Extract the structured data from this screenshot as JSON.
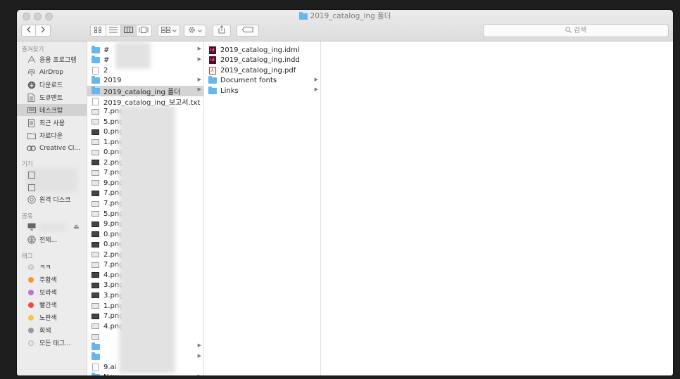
{
  "window": {
    "title": "2019_catalog_ing 폴더"
  },
  "toolbar": {
    "back_icon": "chevron-left-icon",
    "forward_icon": "chevron-right-icon",
    "view_modes": [
      "icon-view-icon",
      "list-view-icon",
      "column-view-icon",
      "gallery-view-icon"
    ],
    "search_placeholder": "검색"
  },
  "sidebar": {
    "favorites_header": "즐겨찾기",
    "favorites": [
      {
        "label": "응용 프로그램",
        "icon": "applications-icon"
      },
      {
        "label": "AirDrop",
        "icon": "airdrop-icon"
      },
      {
        "label": "다운로드",
        "icon": "download-icon"
      },
      {
        "label": "도큐멘트",
        "icon": "document-icon"
      },
      {
        "label": "데스크탑",
        "icon": "desktop-icon"
      },
      {
        "label": "최근 사용",
        "icon": "recents-icon"
      },
      {
        "label": "자료다운",
        "icon": "folder-icon"
      },
      {
        "label": "Creative Cl...",
        "icon": "creative-cloud-icon"
      }
    ],
    "devices_header": "기기",
    "devices": [
      {
        "label": "원격 디스크",
        "icon": "remote-disc-icon"
      }
    ],
    "shared_header": "공유",
    "shared": [
      {
        "label": "전체...",
        "icon": "network-icon"
      }
    ],
    "tags_header": "태그",
    "tags": [
      {
        "label": "ㅋㅋ",
        "color": "#d8d8d8"
      },
      {
        "label": "주황색",
        "color": "#f39a2d"
      },
      {
        "label": "보라색",
        "color": "#c06fd9"
      },
      {
        "label": "빨간색",
        "color": "#ee4a4a"
      },
      {
        "label": "노란색",
        "color": "#f2c93a"
      },
      {
        "label": "회색",
        "color": "#9a9a9a"
      },
      {
        "label": "모든 태그...",
        "color": "#d0d0d0"
      }
    ]
  },
  "column1": {
    "items": [
      {
        "label": "#",
        "kind": "folder",
        "arrow": true
      },
      {
        "label": "#",
        "kind": "folder",
        "arrow": true
      },
      {
        "label": "2",
        "kind": "doc",
        "arrow": false
      },
      {
        "label": "2019",
        "kind": "folder",
        "arrow": true
      },
      {
        "label": "2019_catalog_ing 폴더",
        "kind": "folder",
        "arrow": true,
        "selected": true
      },
      {
        "label": "2019_catalog_ing_보고서.txt",
        "kind": "doc",
        "arrow": false
      },
      {
        "label": "7.png",
        "kind": "thumb"
      },
      {
        "label": "5.png",
        "kind": "thumb"
      },
      {
        "label": "0.png",
        "kind": "thumb-dark"
      },
      {
        "label": "1.png",
        "kind": "thumb"
      },
      {
        "label": "0.png",
        "kind": "thumb"
      },
      {
        "label": "2.png",
        "kind": "thumb-dark"
      },
      {
        "label": "7.png",
        "kind": "thumb"
      },
      {
        "label": "9.png",
        "kind": "thumb"
      },
      {
        "label": "7.png",
        "kind": "thumb-dark"
      },
      {
        "label": "7.png",
        "kind": "thumb"
      },
      {
        "label": "5.png",
        "kind": "thumb"
      },
      {
        "label": "9.png",
        "kind": "thumb-dark"
      },
      {
        "label": "0.png",
        "kind": "thumb-dark"
      },
      {
        "label": "0.png",
        "kind": "thumb-dark"
      },
      {
        "label": "2.png",
        "kind": "thumb"
      },
      {
        "label": "7.png",
        "kind": "thumb"
      },
      {
        "label": "4.png",
        "kind": "thumb-dark"
      },
      {
        "label": "3.png",
        "kind": "thumb-dark"
      },
      {
        "label": "3.png",
        "kind": "thumb-dark"
      },
      {
        "label": "1.png",
        "kind": "thumb"
      },
      {
        "label": "7.png",
        "kind": "thumb-dark"
      },
      {
        "label": "4.png",
        "kind": "thumb"
      },
      {
        "label": "",
        "kind": "image"
      },
      {
        "label": "",
        "kind": "folder",
        "arrow": true
      },
      {
        "label": "",
        "kind": "folder",
        "arrow": true
      },
      {
        "label": "9.ai",
        "kind": "doc"
      },
      {
        "label": "New",
        "kind": "folder",
        "arrow": true
      }
    ]
  },
  "column2": {
    "items": [
      {
        "label": "2019_catalog_ing.idml",
        "kind": "indesign",
        "arrow": false
      },
      {
        "label": "2019_catalog_ing.indd",
        "kind": "indesign",
        "arrow": false
      },
      {
        "label": "2019_catalog_ing.pdf",
        "kind": "pdf",
        "arrow": false
      },
      {
        "label": "Document fonts",
        "kind": "folder",
        "arrow": true
      },
      {
        "label": "Links",
        "kind": "folder",
        "arrow": true
      }
    ]
  }
}
